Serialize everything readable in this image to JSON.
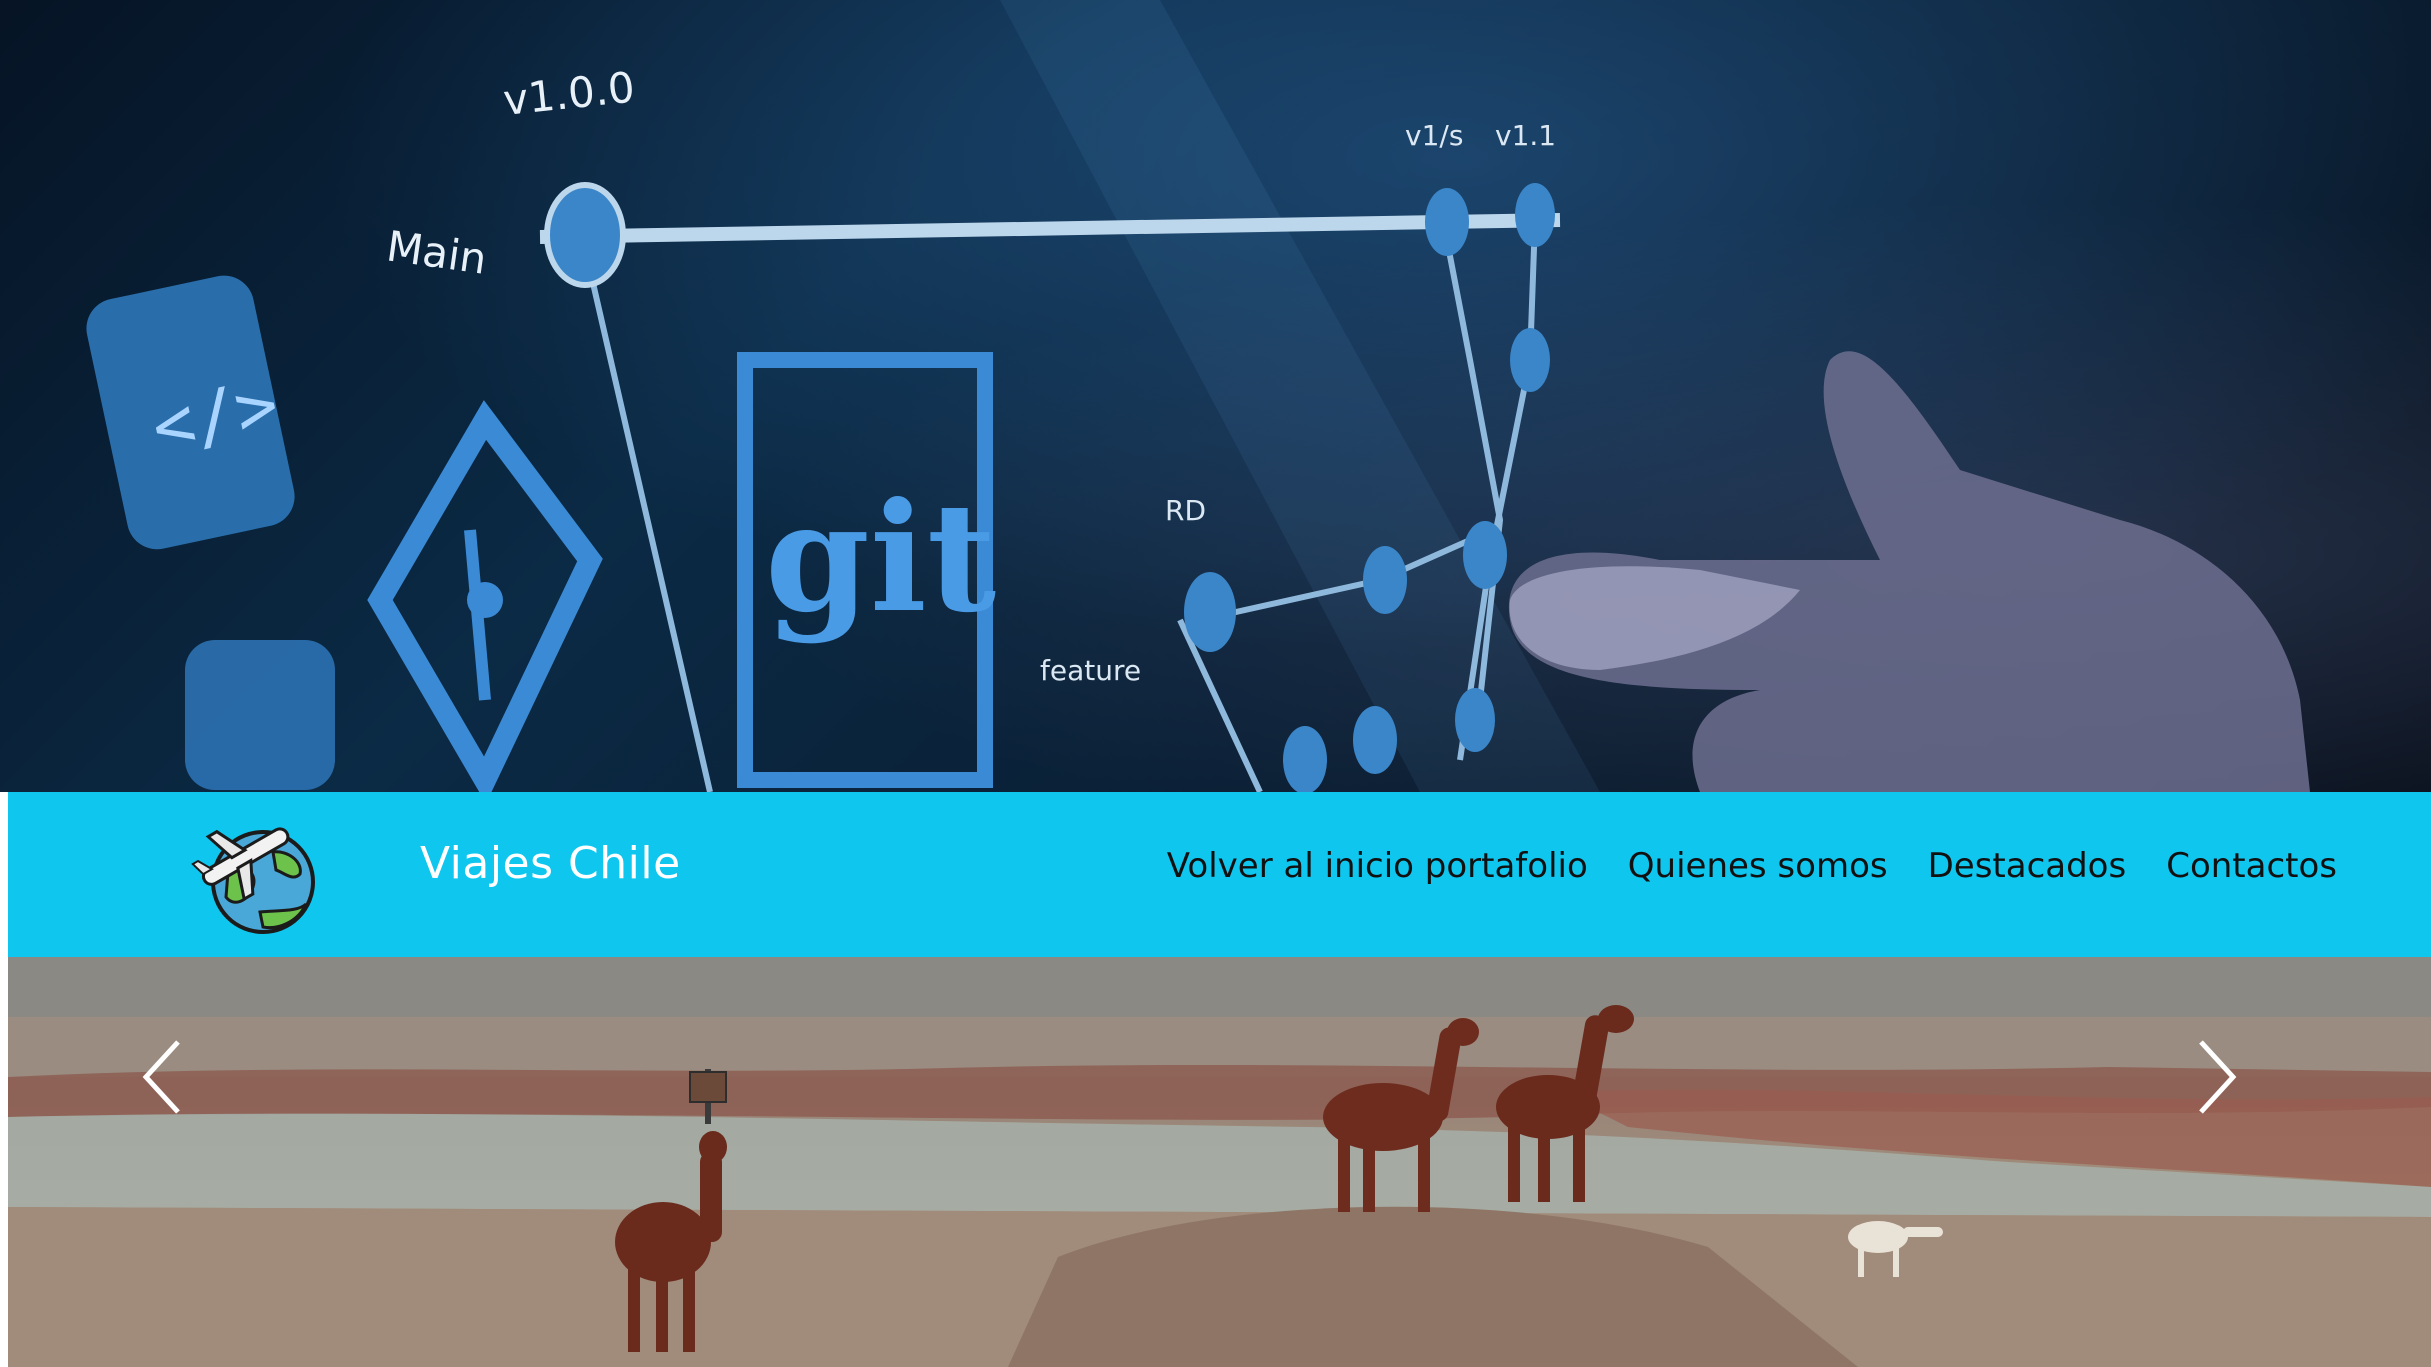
{
  "hero": {
    "image": "git-branching-banner",
    "overlay_texts": [
      "v1.0.0",
      "Main",
      "git"
    ]
  },
  "navbar": {
    "background_color": "#0fc6ef",
    "logo": "travel-globe-airplane-logo",
    "brand": "Viajes Chile",
    "links": [
      {
        "label": "Volver al inicio portafolio"
      },
      {
        "label": "Quienes somos"
      },
      {
        "label": "Destacados"
      },
      {
        "label": "Contactos"
      }
    ]
  },
  "carousel": {
    "image": "llamas-atacama-desert",
    "prev_icon": "chevron-left-icon",
    "next_icon": "chevron-right-icon"
  }
}
